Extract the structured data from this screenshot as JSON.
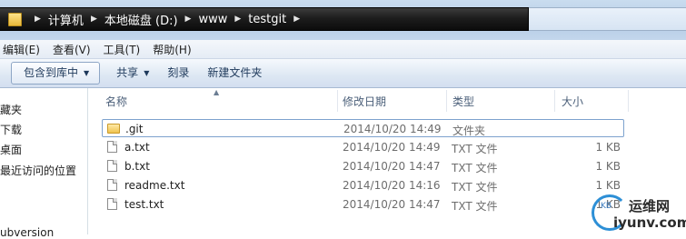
{
  "address_bar": {
    "crumbs": [
      "计算机",
      "本地磁盘 (D:)",
      "www",
      "testgit"
    ]
  },
  "menu": [
    "编辑(E)",
    "查看(V)",
    "工具(T)",
    "帮助(H)"
  ],
  "toolbar": {
    "include_library": "包含到库中",
    "share": "共享",
    "burn": "刻录",
    "new_folder": "新建文件夹"
  },
  "nav_pane": {
    "items": [
      "藏夹",
      "下载",
      "桌面",
      "最近访问的位置",
      "ubversion"
    ]
  },
  "columns": {
    "name": "名称",
    "modified": "修改日期",
    "type": "类型",
    "size": "大小"
  },
  "files": [
    {
      "name": ".git",
      "modified": "2014/10/20 14:49",
      "type": "文件夹",
      "size": "",
      "icon": "folder-icon",
      "selected": true
    },
    {
      "name": "a.txt",
      "modified": "2014/10/20 14:49",
      "type": "TXT 文件",
      "size": "1 KB",
      "icon": "text-file-icon"
    },
    {
      "name": "b.txt",
      "modified": "2014/10/20 14:47",
      "type": "TXT 文件",
      "size": "1 KB",
      "icon": "text-file-icon"
    },
    {
      "name": "readme.txt",
      "modified": "2014/10/20 14:16",
      "type": "TXT 文件",
      "size": "1 KB",
      "icon": "text-file-icon"
    },
    {
      "name": "test.txt",
      "modified": "2014/10/20 14:47",
      "type": "TXT 文件",
      "size": "1 KB",
      "icon": "text-file-icon"
    }
  ],
  "watermark": {
    "badge": "KB",
    "name": "运维网",
    "url": "iyunv.com"
  },
  "colors": {
    "address_bar_bg": "#1d1d1d",
    "toolbar_bg": "#dde7f3",
    "selection_border": "#7da2ce"
  }
}
